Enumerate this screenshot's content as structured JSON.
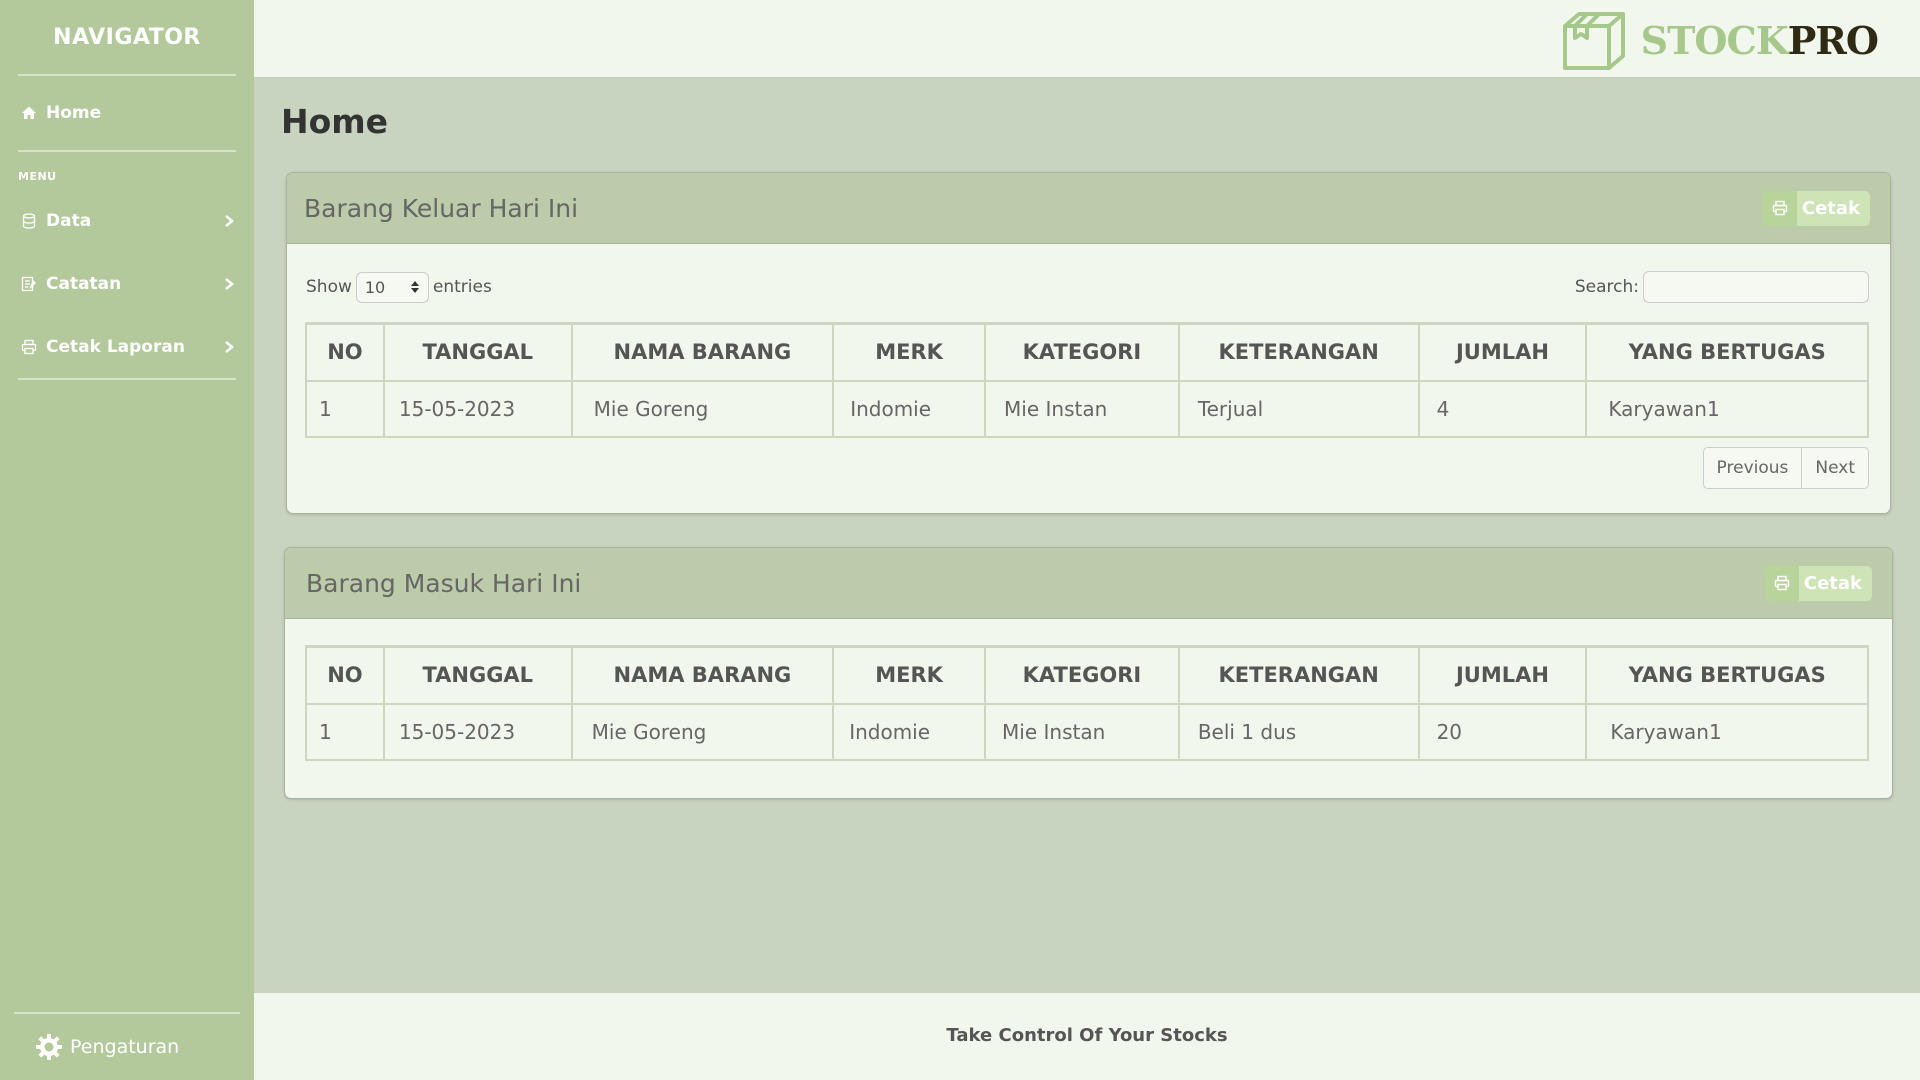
{
  "sidebar": {
    "title": "NAVIGATOR",
    "home_label": "Home",
    "menu_heading": "MENU",
    "items": [
      {
        "label": "Data",
        "icon": "database-icon"
      },
      {
        "label": "Catatan",
        "icon": "notes-icon"
      },
      {
        "label": "Cetak Laporan",
        "icon": "printer-icon"
      }
    ],
    "settings_label": "Pengaturan"
  },
  "brand": {
    "part1": "STOCK",
    "part2": "PRO",
    "accent": "#a7c88b",
    "dark": "#2e2a14"
  },
  "page_title": "Home",
  "keluar": {
    "title": "Barang Keluar Hari Ini",
    "print_label": "Cetak",
    "show_label": "Show",
    "entries_value": "10",
    "entries_label": "entries",
    "search_label": "Search:",
    "search_value": "",
    "columns": [
      "NO",
      "TANGGAL",
      "NAMA BARANG",
      "MERK",
      "KATEGORI",
      "KETERANGAN",
      "JUMLAH",
      "YANG BERTUGAS"
    ],
    "rows": [
      [
        "1",
        "15-05-2023",
        "Mie Goreng",
        "Indomie",
        "Mie Instan",
        "Terjual",
        "4",
        "Karyawan1"
      ]
    ],
    "prev_label": "Previous",
    "next_label": "Next"
  },
  "masuk": {
    "title": "Barang Masuk Hari Ini",
    "print_label": "Cetak",
    "columns": [
      "NO",
      "TANGGAL",
      "NAMA BARANG",
      "MERK",
      "KATEGORI",
      "KETERANGAN",
      "JUMLAH",
      "YANG BERTUGAS"
    ],
    "rows": [
      [
        "1",
        "15-05-2023",
        "Mie Goreng",
        "Indomie",
        "Mie Instan",
        "Beli 1 dus",
        "20",
        "Karyawan1"
      ]
    ]
  },
  "footer": "Take Control Of Your Stocks",
  "colors": {
    "sidebar": "#b3c99b",
    "panel_head": "#bccbaa",
    "background": "#c9d4c0",
    "surface": "#f1f7ec"
  }
}
